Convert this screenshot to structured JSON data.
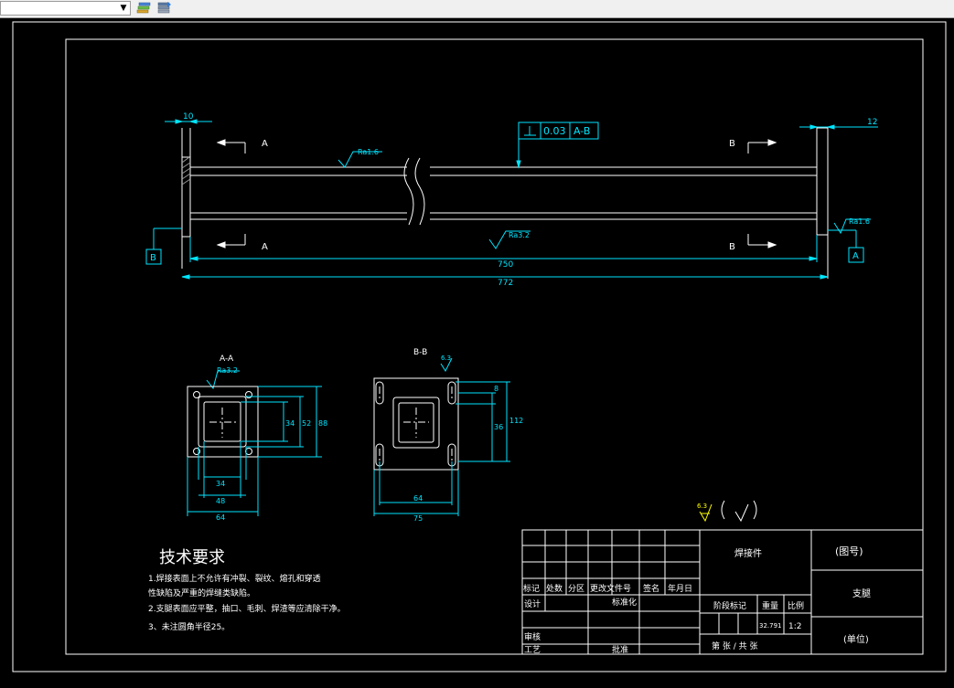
{
  "toolbar": {
    "layer_dropdown_value": "",
    "icons": [
      "layer-properties-icon",
      "layer-previous-icon"
    ]
  },
  "drawing": {
    "dimensions": {
      "top_left": "10",
      "top_right": "12",
      "inner_length": "750",
      "overall_length": "772"
    },
    "section_labels": {
      "a_top": "A",
      "a_bottom": "A",
      "b_top": "B",
      "b_bottom": "B"
    },
    "datums": {
      "left": "B",
      "right": "A"
    },
    "tolerance": {
      "value": "0.03",
      "datum": "A-B"
    },
    "roughness": {
      "top_left": "Ra1.6",
      "bottom_middle": "Ra3.2",
      "right_end": "Ra1.6",
      "section_a": "Ra3.2"
    },
    "section_a": {
      "title": "A-A",
      "dims": {
        "d34_bottom": "34",
        "d48": "48",
        "d64": "64",
        "d34_right": "34",
        "d52": "52",
        "d88": "88"
      }
    },
    "section_b": {
      "title": "B-B",
      "roughness": "6.3",
      "dims": {
        "d64": "64",
        "d75": "75",
        "d8": "8",
        "d36": "36",
        "d112": "112"
      }
    },
    "general_roughness": "6.3"
  },
  "notes": {
    "title": "技术要求",
    "lines": [
      "1.焊接表面上不允许有冲裂、裂纹、熔孔和穿透",
      "性缺陷及严重的焊缝类缺陷。",
      "2.支腿表面应平整，抽口、毛刺、焊渣等应清除干净。",
      "3、未注圆角半径25。"
    ]
  },
  "title_block": {
    "header_row": [
      "标记",
      "处数",
      "分区",
      "更改文件号",
      "签名",
      "年月日"
    ],
    "design": "设计",
    "standardize": "标准化",
    "review": "审核",
    "process": "工艺",
    "approve": "批准",
    "stage_mark": "阶段标记",
    "weight_label": "重量",
    "scale_label": "比例",
    "weight_value": "32.791",
    "scale_value": "1:2",
    "sheets": "第   张 / 共   张",
    "material": "焊接件",
    "drawing_number": "(图号)",
    "part_name": "支腿",
    "unit": "(单位)"
  },
  "status_bar": {
    "text": ""
  },
  "colors": {
    "background": "#000000",
    "geometry": "#ffffff",
    "dimension": "#00e5ff",
    "symbol": "#ffff00"
  }
}
